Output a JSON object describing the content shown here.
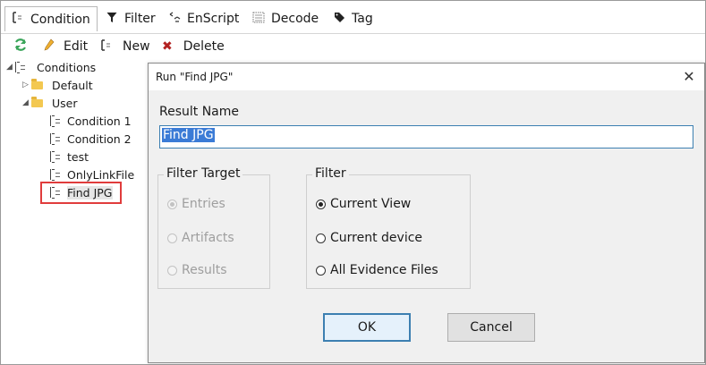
{
  "tabs": [
    {
      "label": "Condition",
      "icon": "condition-icon",
      "active": true
    },
    {
      "label": "Filter",
      "icon": "filter-icon"
    },
    {
      "label": "EnScript",
      "icon": "enscript-icon"
    },
    {
      "label": "Decode",
      "icon": "decode-icon"
    },
    {
      "label": "Tag",
      "icon": "tag-icon"
    }
  ],
  "toolbar": {
    "refresh_icon": "refresh-icon",
    "edit_label": "Edit",
    "new_label": "New",
    "delete_label": "Delete"
  },
  "tree": {
    "root": "Conditions",
    "default_folder": "Default",
    "user_folder": "User",
    "items": [
      "Condition 1",
      "Condition 2",
      "test",
      "OnlyLinkFile",
      "Find JPG"
    ]
  },
  "dialog": {
    "title": "Run \"Find JPG\"",
    "result_name_label": "Result Name",
    "result_name_value": "Find JPG",
    "filter_target": {
      "title": "Filter Target",
      "options": [
        "Entries",
        "Artifacts",
        "Results"
      ],
      "selected": "Entries"
    },
    "filter": {
      "title": "Filter",
      "options": [
        "Current View",
        "Current device",
        "All Evidence Files"
      ],
      "selected": "Current View"
    },
    "ok_label": "OK",
    "cancel_label": "Cancel"
  },
  "colors": {
    "highlight_border": "#e03c3c",
    "selection": "#3b7bd6",
    "folder": "#f3c851",
    "delete_red": "#b22222",
    "refresh_green": "#3aa55a"
  }
}
